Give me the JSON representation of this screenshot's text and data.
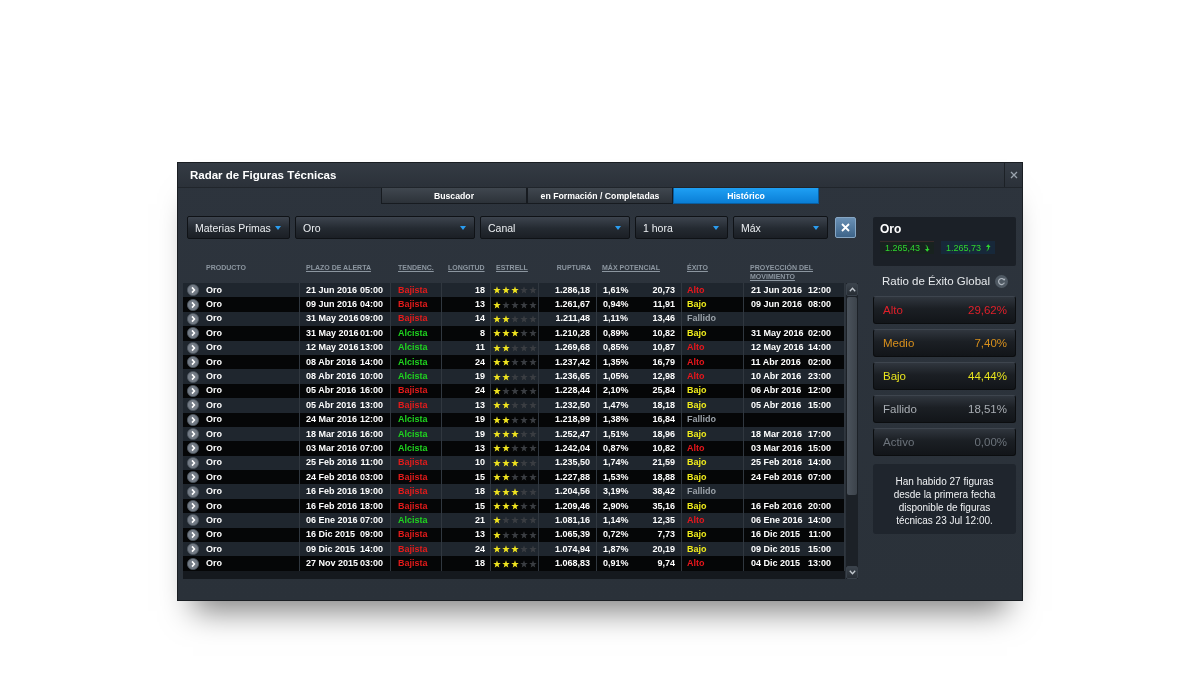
{
  "window": {
    "title": "Radar de Figuras Técnicas"
  },
  "tabs": [
    {
      "label": "Buscador",
      "selected": false
    },
    {
      "label": "en Formación / Completadas",
      "selected": false
    },
    {
      "label": "Histórico",
      "selected": true
    }
  ],
  "filters": [
    {
      "value": "Materias Primas"
    },
    {
      "value": "Oro"
    },
    {
      "value": "Canal"
    },
    {
      "value": "1 hora"
    },
    {
      "value": "Máx"
    }
  ],
  "table": {
    "columns": [
      {
        "label": "PRODUCTO",
        "sortable": false
      },
      {
        "label": "PLAZO DE ALERTA",
        "sortable": true
      },
      {
        "label": "TENDENC.",
        "sortable": true
      },
      {
        "label": "LONGITUD",
        "sortable": true
      },
      {
        "label": "ESTRELL",
        "sortable": true
      },
      {
        "label": "RUPTURA",
        "sortable": false
      },
      {
        "label": "MÁX POTENCIAL",
        "sortable": true
      },
      {
        "label": "ÉXITO",
        "sortable": true
      },
      {
        "label": "PROYECCIÓN DEL MOVIMIENTO",
        "sortable": true
      }
    ],
    "rows": [
      {
        "product": "Oro",
        "alert_date": "21 Jun 2016",
        "alert_time": "05:00",
        "trend": {
          "text": "Bajista",
          "kind": "bearish"
        },
        "length": "18",
        "stars": 3,
        "breakout": "1.286,18",
        "potential_pct": "1,61%",
        "potential": "20,73",
        "success": {
          "text": "Alto",
          "kind": "high"
        },
        "projection_date": "21 Jun 2016",
        "projection_time": "12:00"
      },
      {
        "product": "Oro",
        "alert_date": "09 Jun 2016",
        "alert_time": "04:00",
        "trend": {
          "text": "Bajista",
          "kind": "bearish"
        },
        "length": "13",
        "stars": 1,
        "breakout": "1.261,67",
        "potential_pct": "0,94%",
        "potential": "11,91",
        "success": {
          "text": "Bajo",
          "kind": "low"
        },
        "projection_date": "09 Jun 2016",
        "projection_time": "08:00"
      },
      {
        "product": "Oro",
        "alert_date": "31 May 2016",
        "alert_time": "09:00",
        "trend": {
          "text": "Bajista",
          "kind": "bearish"
        },
        "length": "14",
        "stars": 2,
        "breakout": "1.211,48",
        "potential_pct": "1,11%",
        "potential": "13,46",
        "success": {
          "text": "Fallido",
          "kind": "failed"
        }
      },
      {
        "product": "Oro",
        "alert_date": "31 May 2016",
        "alert_time": "01:00",
        "trend": {
          "text": "Alcista",
          "kind": "bullish"
        },
        "length": "8",
        "stars": 3,
        "breakout": "1.210,28",
        "potential_pct": "0,89%",
        "potential": "10,82",
        "success": {
          "text": "Bajo",
          "kind": "low"
        },
        "projection_date": "31 May 2016",
        "projection_time": "02:00"
      },
      {
        "product": "Oro",
        "alert_date": "12 May 2016",
        "alert_time": "13:00",
        "trend": {
          "text": "Alcista",
          "kind": "bullish"
        },
        "length": "11",
        "stars": 2,
        "breakout": "1.269,68",
        "potential_pct": "0,85%",
        "potential": "10,87",
        "success": {
          "text": "Alto",
          "kind": "high"
        },
        "projection_date": "12 May 2016",
        "projection_time": "14:00"
      },
      {
        "product": "Oro",
        "alert_date": "08 Abr 2016",
        "alert_time": "14:00",
        "trend": {
          "text": "Alcista",
          "kind": "bullish"
        },
        "length": "24",
        "stars": 2,
        "breakout": "1.237,42",
        "potential_pct": "1,35%",
        "potential": "16,79",
        "success": {
          "text": "Alto",
          "kind": "high"
        },
        "projection_date": "11 Abr 2016",
        "projection_time": "02:00"
      },
      {
        "product": "Oro",
        "alert_date": "08 Abr 2016",
        "alert_time": "10:00",
        "trend": {
          "text": "Alcista",
          "kind": "bullish"
        },
        "length": "19",
        "stars": 2,
        "breakout": "1.236,65",
        "potential_pct": "1,05%",
        "potential": "12,98",
        "success": {
          "text": "Alto",
          "kind": "high"
        },
        "projection_date": "10 Abr 2016",
        "projection_time": "23:00"
      },
      {
        "product": "Oro",
        "alert_date": "05 Abr 2016",
        "alert_time": "16:00",
        "trend": {
          "text": "Bajista",
          "kind": "bearish"
        },
        "length": "24",
        "stars": 1,
        "breakout": "1.228,44",
        "potential_pct": "2,10%",
        "potential": "25,84",
        "success": {
          "text": "Bajo",
          "kind": "low"
        },
        "projection_date": "06 Abr 2016",
        "projection_time": "12:00"
      },
      {
        "product": "Oro",
        "alert_date": "05 Abr 2016",
        "alert_time": "13:00",
        "trend": {
          "text": "Bajista",
          "kind": "bearish"
        },
        "length": "13",
        "stars": 2,
        "breakout": "1.232,50",
        "potential_pct": "1,47%",
        "potential": "18,18",
        "success": {
          "text": "Bajo",
          "kind": "low"
        },
        "projection_date": "05 Abr 2016",
        "projection_time": "15:00"
      },
      {
        "product": "Oro",
        "alert_date": "24 Mar 2016",
        "alert_time": "12:00",
        "trend": {
          "text": "Alcista",
          "kind": "bullish"
        },
        "length": "19",
        "stars": 2,
        "breakout": "1.218,99",
        "potential_pct": "1,38%",
        "potential": "16,84",
        "success": {
          "text": "Fallido",
          "kind": "failed"
        }
      },
      {
        "product": "Oro",
        "alert_date": "18 Mar 2016",
        "alert_time": "16:00",
        "trend": {
          "text": "Alcista",
          "kind": "bullish"
        },
        "length": "19",
        "stars": 3,
        "breakout": "1.252,47",
        "potential_pct": "1,51%",
        "potential": "18,96",
        "success": {
          "text": "Bajo",
          "kind": "low"
        },
        "projection_date": "18 Mar 2016",
        "projection_time": "17:00"
      },
      {
        "product": "Oro",
        "alert_date": "03 Mar 2016",
        "alert_time": "07:00",
        "trend": {
          "text": "Alcista",
          "kind": "bullish"
        },
        "length": "13",
        "stars": 2,
        "breakout": "1.242,04",
        "potential_pct": "0,87%",
        "potential": "10,82",
        "success": {
          "text": "Alto",
          "kind": "high"
        },
        "projection_date": "03 Mar 2016",
        "projection_time": "15:00"
      },
      {
        "product": "Oro",
        "alert_date": "25 Feb 2016",
        "alert_time": "11:00",
        "trend": {
          "text": "Bajista",
          "kind": "bearish"
        },
        "length": "10",
        "stars": 3,
        "breakout": "1.235,50",
        "potential_pct": "1,74%",
        "potential": "21,59",
        "success": {
          "text": "Bajo",
          "kind": "low"
        },
        "projection_date": "25 Feb 2016",
        "projection_time": "14:00"
      },
      {
        "product": "Oro",
        "alert_date": "24 Feb 2016",
        "alert_time": "03:00",
        "trend": {
          "text": "Bajista",
          "kind": "bearish"
        },
        "length": "15",
        "stars": 2,
        "breakout": "1.227,88",
        "potential_pct": "1,53%",
        "potential": "18,88",
        "success": {
          "text": "Bajo",
          "kind": "low"
        },
        "projection_date": "24 Feb 2016",
        "projection_time": "07:00"
      },
      {
        "product": "Oro",
        "alert_date": "16 Feb 2016",
        "alert_time": "19:00",
        "trend": {
          "text": "Bajista",
          "kind": "bearish"
        },
        "length": "18",
        "stars": 3,
        "breakout": "1.204,56",
        "potential_pct": "3,19%",
        "potential": "38,42",
        "success": {
          "text": "Fallido",
          "kind": "failed"
        }
      },
      {
        "product": "Oro",
        "alert_date": "16 Feb 2016",
        "alert_time": "18:00",
        "trend": {
          "text": "Bajista",
          "kind": "bearish"
        },
        "length": "15",
        "stars": 3,
        "breakout": "1.209,46",
        "potential_pct": "2,90%",
        "potential": "35,16",
        "success": {
          "text": "Bajo",
          "kind": "low"
        },
        "projection_date": "16 Feb 2016",
        "projection_time": "20:00"
      },
      {
        "product": "Oro",
        "alert_date": "06 Ene 2016",
        "alert_time": "07:00",
        "trend": {
          "text": "Alcista",
          "kind": "bullish"
        },
        "length": "21",
        "stars": 1,
        "breakout": "1.081,16",
        "potential_pct": "1,14%",
        "potential": "12,35",
        "success": {
          "text": "Alto",
          "kind": "high"
        },
        "projection_date": "06 Ene 2016",
        "projection_time": "14:00"
      },
      {
        "product": "Oro",
        "alert_date": "16 Dic 2015",
        "alert_time": "09:00",
        "trend": {
          "text": "Bajista",
          "kind": "bearish"
        },
        "length": "13",
        "stars": 1,
        "breakout": "1.065,39",
        "potential_pct": "0,72%",
        "potential": "7,73",
        "success": {
          "text": "Bajo",
          "kind": "low"
        },
        "projection_date": "16 Dic 2015",
        "projection_time": "11:00"
      },
      {
        "product": "Oro",
        "alert_date": "09 Dic 2015",
        "alert_time": "14:00",
        "trend": {
          "text": "Bajista",
          "kind": "bearish"
        },
        "length": "24",
        "stars": 3,
        "breakout": "1.074,94",
        "potential_pct": "1,87%",
        "potential": "20,19",
        "success": {
          "text": "Bajo",
          "kind": "low"
        },
        "projection_date": "09 Dic 2015",
        "projection_time": "15:00"
      },
      {
        "product": "Oro",
        "alert_date": "27 Nov 2015",
        "alert_time": "03:00",
        "trend": {
          "text": "Bajista",
          "kind": "bearish"
        },
        "length": "18",
        "stars": 3,
        "breakout": "1.068,83",
        "potential_pct": "0,91%",
        "potential": "9,74",
        "success": {
          "text": "Alto",
          "kind": "high"
        },
        "projection_date": "04 Dic 2015",
        "projection_time": "13:00"
      }
    ]
  },
  "quote": {
    "name": "Oro",
    "bid": "1.265,43",
    "ask": "1.265,73"
  },
  "success_ratio": {
    "title": "Ratio de Éxito Global",
    "levels": [
      {
        "label": "Alto",
        "value": "29,62%",
        "color": "#e0202a"
      },
      {
        "label": "Medio",
        "value": "7,40%",
        "color": "#d8901c"
      },
      {
        "label": "Bajo",
        "value": "44,44%",
        "color": "#e8e41e"
      },
      {
        "label": "Fallido",
        "value": "18,51%",
        "color": "#a8adb3"
      },
      {
        "label": "Activo",
        "value": "0,00%",
        "color": "#6c737b"
      }
    ]
  },
  "summary": "Han habido 27 figuras desde la primera fecha disponible de figuras técnicas 23 Jul 12:00."
}
